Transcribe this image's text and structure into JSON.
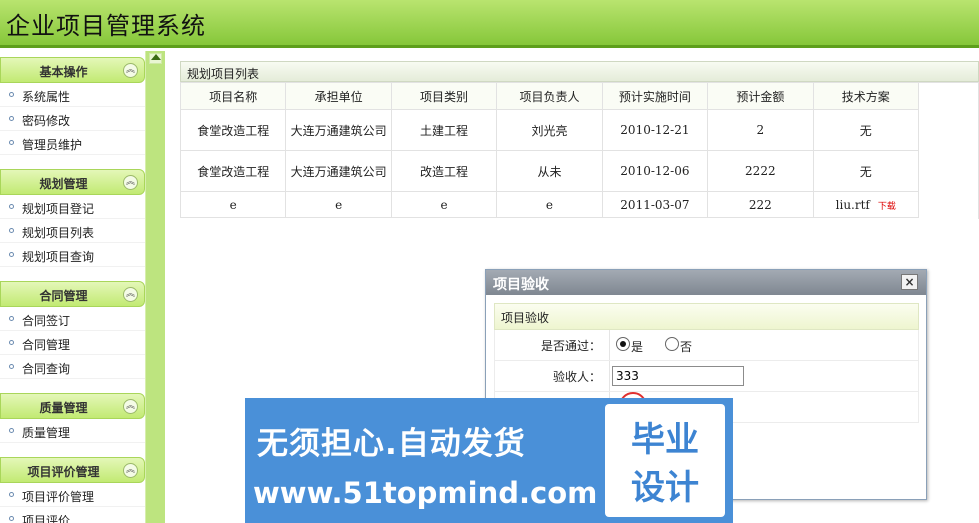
{
  "app": {
    "title": "企业项目管理系统"
  },
  "sidebar": {
    "sections": [
      {
        "title": "基本操作",
        "items": [
          "系统属性",
          "密码修改",
          "管理员维护"
        ]
      },
      {
        "title": "规划管理",
        "items": [
          "规划项目登记",
          "规划项目列表",
          "规划项目查询"
        ]
      },
      {
        "title": "合同管理",
        "items": [
          "合同签订",
          "合同管理",
          "合同查询"
        ]
      },
      {
        "title": "质量管理",
        "items": [
          "质量管理"
        ]
      },
      {
        "title": "项目评价管理",
        "items": [
          "项目评价管理",
          "项目评价"
        ]
      }
    ],
    "toggle_glyph": "︽"
  },
  "list": {
    "caption": "规划项目列表",
    "columns": [
      "项目名称",
      "承担单位",
      "项目类别",
      "项目负责人",
      "预计实施时间",
      "预计金额",
      "技术方案"
    ],
    "rows": [
      [
        "食堂改造工程",
        "大连万通建筑公司",
        "土建工程",
        "刘光亮",
        "2010-12-21",
        "2",
        "无"
      ],
      [
        "食堂改造工程",
        "大连万通建筑公司",
        "改造工程",
        "从未",
        "2010-12-06",
        "2222",
        "无"
      ],
      [
        "e",
        "e",
        "e",
        "e",
        "2011-03-07",
        "222",
        "liu.rtf"
      ]
    ],
    "download_label": "下载"
  },
  "dialog": {
    "title": "项目验收",
    "close_glyph": "×",
    "panel_title": "项目验收",
    "pass_label": "是否通过：",
    "yes_label": "是",
    "no_label": "否",
    "pass_selected": "是",
    "inspector_label": "验收人：",
    "inspector_value": "333"
  },
  "banner": {
    "line1": "无须担心.自动发货",
    "line2": "www.51topmind.com",
    "badge_line1": "毕业",
    "badge_line2": "设计"
  }
}
